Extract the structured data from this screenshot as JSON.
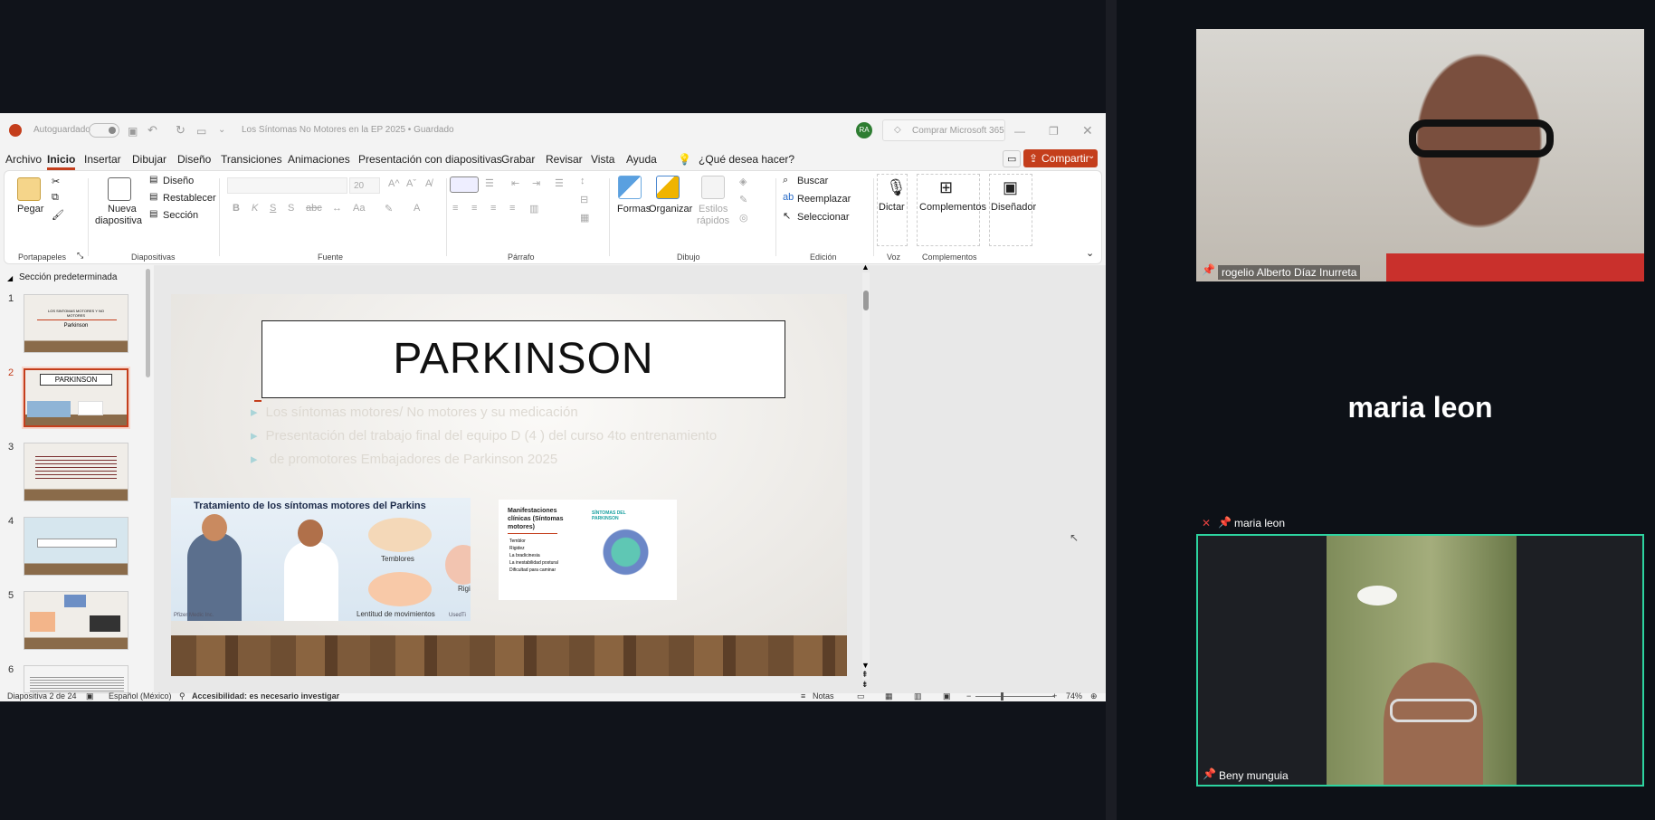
{
  "titlebar": {
    "autosave_label": "Autoguardado",
    "doc_title": "Los Síntomas No Motores en la EP 2025 • Guardado",
    "avatar_initials": "RA",
    "buy_label": "Comprar Microsoft 365"
  },
  "menu": [
    "Archivo",
    "Inicio",
    "Insertar",
    "Dibujar",
    "Diseño",
    "Transiciones",
    "Animaciones",
    "Presentación con diapositivas",
    "Grabar",
    "Revisar",
    "Vista",
    "Ayuda"
  ],
  "menu_active": "Inicio",
  "search_prompt": "¿Qué desea hacer?",
  "share_label": "Compartir",
  "ribbon": {
    "paste": "Pegar",
    "new_slide_line1": "Nueva",
    "new_slide_line2": "diapositiva",
    "layout": "Diseño",
    "reset": "Restablecer",
    "section": "Sección",
    "font_size": "20",
    "quick_styles_line1": "Estilos",
    "quick_styles_line2": "rápidos",
    "shapes": "Formas",
    "arrange": "Organizar",
    "find": "Buscar",
    "replace": "Reemplazar",
    "select": "Seleccionar",
    "dictate": "Dictar",
    "addins": "Complementos",
    "designer": "Diseñador",
    "groups": {
      "clipboard": "Portapapeles",
      "slides": "Diapositivas",
      "font": "Fuente",
      "paragraph": "Párrafo",
      "drawing": "Dibujo",
      "editing": "Edición",
      "voice": "Voz",
      "addins": "Complementos"
    }
  },
  "thumbnails": {
    "section_label": "Sección predeterminada",
    "numbers": [
      "1",
      "2",
      "3",
      "4",
      "5",
      "6"
    ],
    "thumb1_line1": "LOS SINTOMAS MOTORES Y NO",
    "thumb1_line2": "MOTORES",
    "thumb1_line3": "Parkinson",
    "thumb2_title": "PARKINSON"
  },
  "slide": {
    "title": "PARKINSON",
    "bullets": [
      "Los síntomas motores/ No motores y su medicación",
      "Presentación del trabajo final del equipo  D (4 ) del curso 4to entrenamiento",
      " de promotores Embajadores de Parkinson 2025"
    ],
    "image1": {
      "title": "Tratamiento de los síntomas motores del Parkins",
      "label_tremor": "Temblores",
      "label_slow": "Lentitud de movimientos",
      "label_rigid": "Rigi",
      "credit": "Pfizer Medic Inc.",
      "credit2": "UsedTi"
    },
    "image2": {
      "title": "Manifestaciones clínicas (Síntomas motores)",
      "items": [
        "Temblor",
        "Rigidez",
        "La bradicinesia",
        "La inestabilidad postural",
        "Dificultad para caminar"
      ],
      "badge": "SÍNTOMAS DEL PARKINSON"
    }
  },
  "statusbar": {
    "slide_count": "Diapositiva 2 de 24",
    "language": "Español (México)",
    "accessibility": "Accesibilidad: es necesario investigar",
    "notes": "Notas",
    "zoom": "74%"
  },
  "participants": {
    "p1_name": "rogelio Alberto Díaz Inurreta",
    "p2_name": "maria leon",
    "p2_tag": "maria leon",
    "p3_name": "Beny munguia"
  },
  "colors": {
    "accent": "#c43e1c",
    "active_speaker": "#2dd4a0",
    "call_bg": "#0d1117"
  }
}
